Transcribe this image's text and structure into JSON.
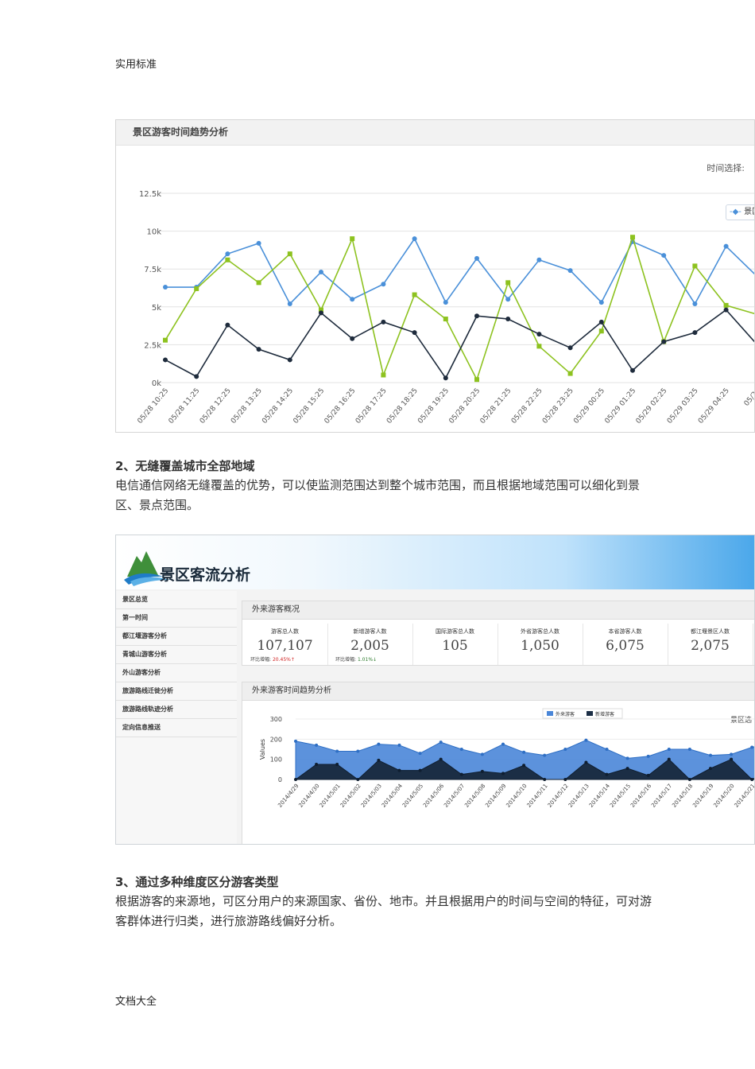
{
  "page": {
    "header": "实用标准",
    "footer": "文档大全"
  },
  "figure1": {
    "title": "景区游客时间趋势分析",
    "time_label": "时间选择:",
    "legend_label": "景区"
  },
  "section2": {
    "title": "2、无缝覆盖城市全部地域",
    "body": "电信通信网络无缝覆盖的优势，可以使监测范围达到整个城市范围，而且根据地域范围可以细化到景区、景点范围。"
  },
  "section3": {
    "title": "3、通过多种维度区分游客类型",
    "body": "根据游客的来源地，可区分用户的来源国家、省份、地市。并且根据用户的时间与空间的特征，可对游客群体进行归类，进行旅游路线偏好分析。"
  },
  "figure2": {
    "app_title": "景区客流分析",
    "sidebar": [
      "景区总览",
      "第一时间",
      "都江堰游客分析",
      "青城山游客分析",
      "外山游客分析",
      "旅游路线迁徙分析",
      "旅游路线轨迹分析",
      "定向信息推送"
    ],
    "overview_title": "外来游客概况",
    "kpis": [
      {
        "label": "游客总人数",
        "value": "107,107",
        "change_label": "环比增幅:",
        "change": "20.45%↑"
      },
      {
        "label": "新增游客人数",
        "value": "2,005",
        "change_label": "环比增幅:",
        "change": "1.01%↓"
      },
      {
        "label": "国际游客总人数",
        "value": "105"
      },
      {
        "label": "外省游客总人数",
        "value": "1,050"
      },
      {
        "label": "本省游客人数",
        "value": "6,075"
      },
      {
        "label": "都江堰景区人数",
        "value": "2,075"
      }
    ],
    "trend_title": "外来游客时间趋势分析",
    "trend_right_label": "景区选",
    "legend": [
      "外来游客",
      "新增游客"
    ]
  },
  "chart_data": [
    {
      "type": "line",
      "title": "景区游客时间趋势分析",
      "categories": [
        "05/28 10:25",
        "05/28 11:25",
        "05/28 12:25",
        "05/28 13:25",
        "05/28 14:25",
        "05/28 15:25",
        "05/28 16:25",
        "05/28 17:25",
        "05/28 18:25",
        "05/28 19:25",
        "05/28 20:25",
        "05/28 21:25",
        "05/28 22:25",
        "05/28 23:25",
        "05/29 00:25",
        "05/29 01:25",
        "05/29 02:25",
        "05/29 03:25",
        "05/29 04:25",
        "05/29"
      ],
      "y_ticks": [
        "0k",
        "2.5k",
        "5k",
        "7.5k",
        "10k",
        "12.5k"
      ],
      "ylim": [
        0,
        12500
      ],
      "grid": true,
      "series": [
        {
          "name": "景区",
          "color": "#4a90d9",
          "values": [
            6300,
            6300,
            8500,
            9200,
            5200,
            7300,
            5500,
            6500,
            9500,
            5300,
            8200,
            5500,
            8100,
            7400,
            5300,
            9300,
            8400,
            5200,
            9000,
            7000
          ]
        },
        {
          "color": "#8dc21f",
          "values": [
            2800,
            6200,
            8100,
            6600,
            8500,
            4800,
            9500,
            500,
            5800,
            4200,
            200,
            6600,
            2400,
            600,
            3400,
            9600,
            2700,
            7700,
            5100,
            4500
          ]
        },
        {
          "color": "#1e2b3c",
          "values": [
            1500,
            400,
            3800,
            2200,
            1500,
            4600,
            2900,
            4000,
            3300,
            300,
            4400,
            4200,
            3200,
            2300,
            4000,
            800,
            2700,
            3300,
            4800,
            2500
          ]
        }
      ]
    },
    {
      "type": "area",
      "title": "外来游客时间趋势分析",
      "ylabel": "Values",
      "y_ticks": [
        "0",
        "100",
        "200",
        "300"
      ],
      "ylim": [
        0,
        300
      ],
      "categories": [
        "2014/4/29",
        "2014/4/30",
        "2014/5/01",
        "2014/5/02",
        "2014/5/03",
        "2014/5/04",
        "2014/5/05",
        "2014/5/06",
        "2014/5/07",
        "2014/5/08",
        "2014/5/09",
        "2014/5/10",
        "2014/5/11",
        "2014/5/12",
        "2014/5/13",
        "2014/5/14",
        "2014/5/15",
        "2014/5/16",
        "2014/5/17",
        "2014/5/18",
        "2014/5/19",
        "2014/5/20",
        "2014/5/21",
        "201"
      ],
      "series": [
        {
          "name": "外来游客",
          "color": "#4a86d8",
          "values": [
            190,
            170,
            140,
            140,
            175,
            170,
            130,
            185,
            150,
            125,
            175,
            135,
            120,
            150,
            195,
            150,
            105,
            115,
            150,
            150,
            120,
            125,
            160,
            180
          ]
        },
        {
          "name": "新增游客",
          "color": "#1b2e45",
          "values": [
            0,
            75,
            75,
            0,
            95,
            45,
            45,
            100,
            25,
            40,
            30,
            70,
            0,
            0,
            85,
            25,
            55,
            20,
            100,
            0,
            55,
            100,
            0,
            55
          ]
        }
      ]
    }
  ]
}
